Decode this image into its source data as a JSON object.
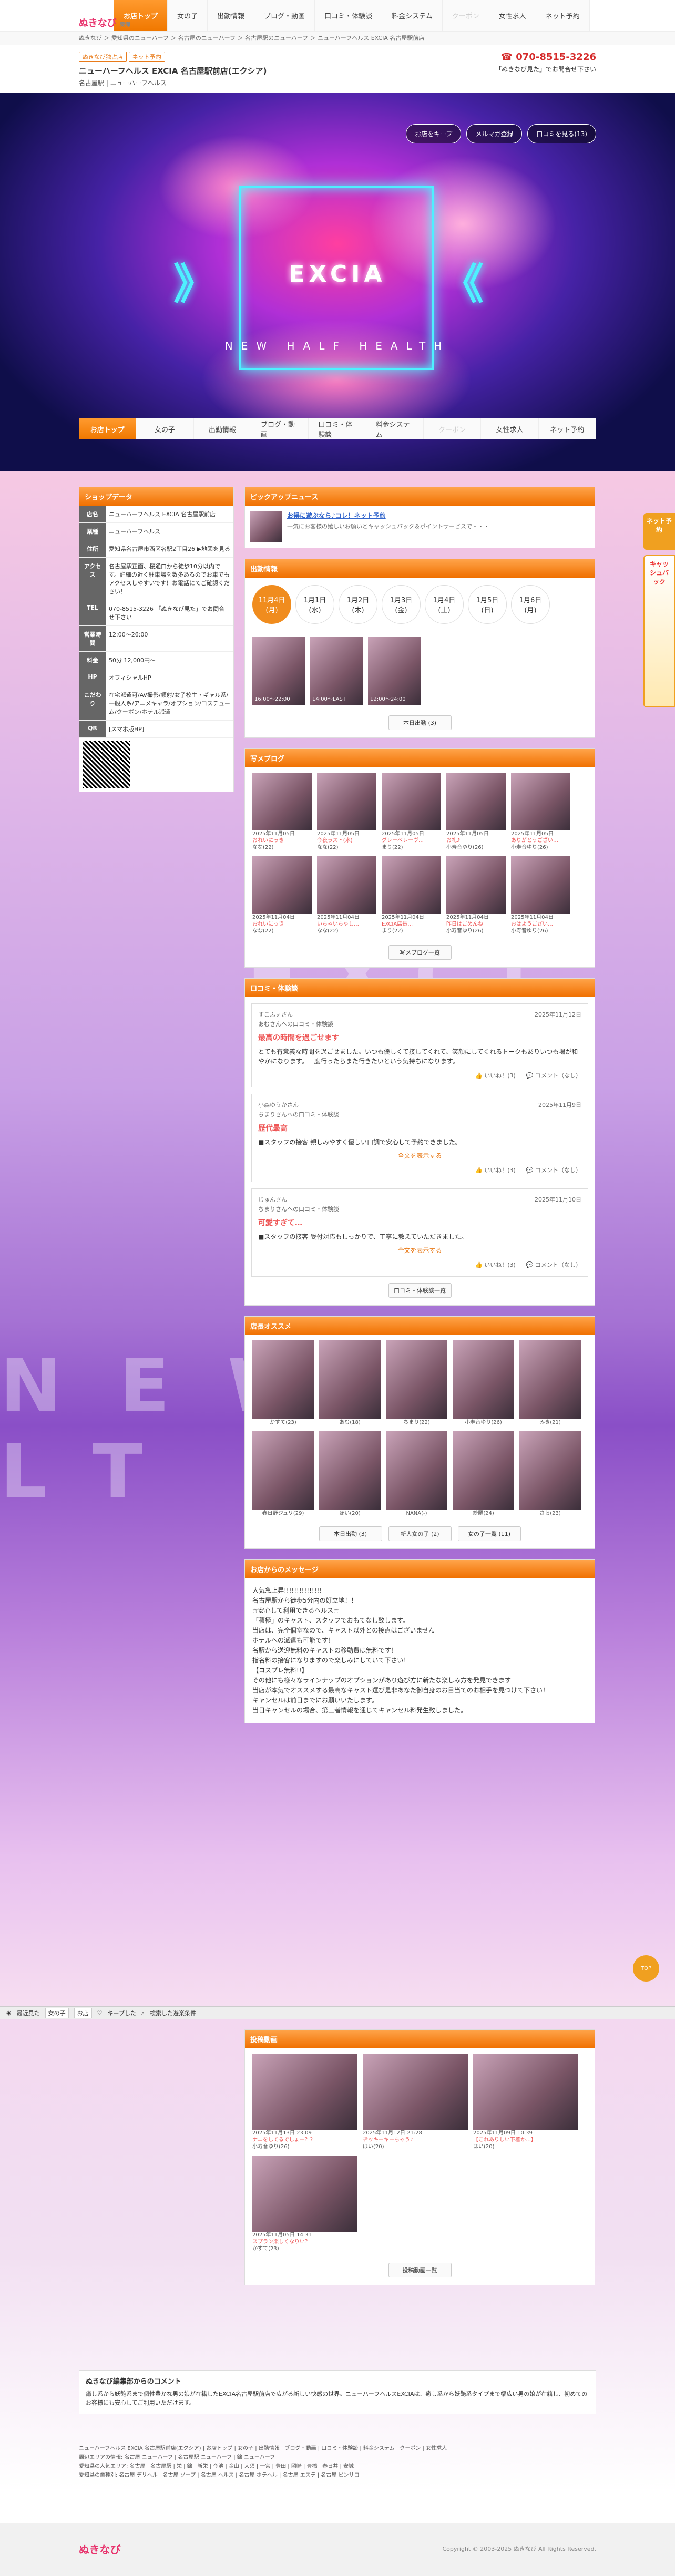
{
  "nav": {
    "logo": "ぬきなび",
    "site_sub": "東海",
    "items": [
      "お店トップ",
      "女の子",
      "出勤情報",
      "ブログ・動画",
      "口コミ・体験談",
      "料金システム",
      "クーポン",
      "女性求人",
      "ネット予約"
    ]
  },
  "breadcrumb": "ぬきなび ＞ 愛知県のニューハーフ ＞ 名古屋のニューハーフ ＞ 名古屋駅のニューハーフ ＞ ニューハーフヘルス EXCIA 名古屋駅前店",
  "shop": {
    "badge1": "ぬきなび独占店",
    "badge2": "ネット予約",
    "name": "ニューハーフヘルス EXCIA 名古屋駅前店(エクシア)",
    "sub": "名古屋駅 | ニューハーフヘルス",
    "tel": "070-8515-3226",
    "tel_note": "「ぬきなび見た」でお問合せ下さい"
  },
  "hero": {
    "btn_keep": "お店をキープ",
    "btn_mail": "メルマガ登録",
    "btn_review": "口コミを見る(13)",
    "logo": "EXCIA",
    "tagline": "NEW HALF HEALTH",
    "chev_left": "》",
    "chev_right": "《"
  },
  "side": {
    "banner1": "ネット予約",
    "banner2": "キャッシュバック",
    "bigtext1": "EXCI",
    "bigtext2": "NEW H LT"
  },
  "shopdata": {
    "title": "ショップデータ",
    "rows": [
      {
        "k": "店名",
        "v": "ニューハーフヘルス EXCIA 名古屋駅前店"
      },
      {
        "k": "業種",
        "v": "ニューハーフヘルス"
      },
      {
        "k": "住所",
        "v": "愛知県名古屋市西区名駅2丁目26 ▶地図を見る"
      },
      {
        "k": "アクセス",
        "v": "名古屋駅正面、桜通口から徒歩10分以内です。詳細の近く駐車場を数多あるのでお車でもアクセスしやすいです！お電話にてご確認ください！"
      },
      {
        "k": "TEL",
        "v": "070-8515-3226 「ぬきなび見た」でお問合せ下さい"
      },
      {
        "k": "営業時間",
        "v": "12:00〜26:00"
      },
      {
        "k": "料金",
        "v": "50分 12,000円〜"
      },
      {
        "k": "HP",
        "v": "オフィシャルHP"
      },
      {
        "k": "こだわり",
        "v": "在宅派遣可/AV撮影/顔射/女子校生・ギャル系/一般人系/アニメキャラ/オプション/コスチューム/クーポン/ホテル派遣"
      },
      {
        "k": "QR",
        "v": "[スマホ版HP]"
      }
    ]
  },
  "pickup": {
    "title": "ピックアップニュース",
    "headline": "お得に遊ぶなら♪コレ！ネット予約",
    "body": "一気にお客様の嬉しいお願いとキャッシュバック＆ポイントサービスで・・・"
  },
  "schedule": {
    "title": "出勤情報",
    "days": [
      {
        "d": "11月4日",
        "w": "(月)"
      },
      {
        "d": "1月1日",
        "w": "(水)"
      },
      {
        "d": "1月2日",
        "w": "(木)"
      },
      {
        "d": "1月3日",
        "w": "(金)"
      },
      {
        "d": "1月4日",
        "w": "(土)"
      },
      {
        "d": "1月5日",
        "w": "(日)"
      },
      {
        "d": "1月6日",
        "w": "(月)"
      }
    ],
    "caps": [
      "16:00〜22:00",
      "14:00〜LAST",
      "12:00〜24:00"
    ],
    "more": "本日出勤 (3)"
  },
  "blog": {
    "title": "写メブログ",
    "items": [
      {
        "t": "2025年11月05日",
        "h": "おれいにっき",
        "n": "なな(22)"
      },
      {
        "t": "2025年11月05日",
        "h": "今夜ラスト(水)",
        "n": "なな(22)"
      },
      {
        "t": "2025年11月05日",
        "h": "グレーベレーヴ…",
        "n": "まり(22)"
      },
      {
        "t": "2025年11月05日",
        "h": "お礼♪",
        "n": "小寿音ゆり(26)"
      },
      {
        "t": "2025年11月05日",
        "h": "ありがとうござい…",
        "n": "小寿音ゆり(26)"
      },
      {
        "t": "2025年11月04日",
        "h": "おれいにっき",
        "n": "なな(22)"
      },
      {
        "t": "2025年11月04日",
        "h": "いちゃいちゃし…",
        "n": "なな(22)"
      },
      {
        "t": "2025年11月04日",
        "h": "EXCIA店長…",
        "n": "まり(22)"
      },
      {
        "t": "2025年11月04日",
        "h": "昨日はごめんね",
        "n": "小寿音ゆり(26)"
      },
      {
        "t": "2025年11月04日",
        "h": "おはようござい…",
        "n": "小寿音ゆり(26)"
      }
    ],
    "more": "写メブログ一覧"
  },
  "reviews": {
    "title": "口コミ・体験談",
    "items": [
      {
        "user": "すこふぇさん",
        "to": "あむさんへの口コミ・体験談",
        "date": "2025年11月12日",
        "head": "最高の時間を過ごせます",
        "body": "とても有意義な時間を過ごせました。いつも優しくて接してくれて、笑顔にしてくれるトークもありいつも場が和やかになります。一度行ったらまた行きたいという気持ちになります。",
        "like": "いいね！(3)",
        "com": "コメント（なし）"
      },
      {
        "user": "小森ゆうかさん",
        "to": "ちまりさんへの口コミ・体験談",
        "date": "2025年11月9日",
        "head": "歴代最高",
        "body": "■スタッフの接客 親しみやすく優しい口調で安心して予約できました。",
        "like": "いいね！(3)",
        "com": "コメント（なし）",
        "more": "全文を表示する"
      },
      {
        "user": "じゅんさん",
        "to": "ちまりさんへの口コミ・体験談",
        "date": "2025年11月10日",
        "head": "可愛すぎて…",
        "body": "■スタッフの接客 受付対応もしっかりで、丁寧に教えていただきました。",
        "like": "いいね！(3)",
        "com": "コメント（なし）",
        "more": "全文を表示する"
      }
    ],
    "more": "口コミ・体験談一覧"
  },
  "girls": {
    "title": "店長オススメ",
    "items": [
      "かすて(23)",
      "あむ(18)",
      "ちまり(22)",
      "小寿音ゆり(26)",
      "みき(21)",
      "春日野ジュリ(29)",
      "ほい(20)",
      "NANA(-)",
      "紗羅(24)",
      "さら(23)"
    ],
    "b1": "本日出勤 (3)",
    "b2": "新人女の子 (2)",
    "b3": "女の子一覧 (11)"
  },
  "message": {
    "title": "お店からのメッセージ",
    "lines": [
      "人気急上昇!!!!!!!!!!!!!!!",
      "名古屋駅から徒歩5分内の好立地！！",
      "☆安心して利用できるヘルス☆",
      "「積極」のキャスト、スタッフでおもてなし致します。",
      "当店は、完全個室なので、キャスト以外との接点はございません",
      "ホテルへの派遣も可能です！",
      "名駅から送迎無料のキャストの移動費は無料です！",
      "指名料の接客になりますので楽しみにしていて下さい！",
      "【コスプレ無料!!】",
      "その他にも様々なラインナップのオプションがあり遊び方に新たな楽しみ方を発見できます",
      "当店が本気でオススメする最高なキャスト選び是非あなた御自身のお目当てのお相手を見つけて下さい！",
      "キャンセルは前日までにお願いいたします。",
      "当日キャンセルの場合、第三者情報を通じてキャンセル料発生致しました。"
    ]
  },
  "posts": {
    "title": "投稿動画",
    "items": [
      {
        "t": "2025年11月13日 23:09",
        "h": "ナニをしてるでしょー？？",
        "n": "小寿音ゆり(26)"
      },
      {
        "t": "2025年11月12日 21:28",
        "h": "ヂッキーキーちゃう♪",
        "n": "ほい(20)"
      },
      {
        "t": "2025年11月09日 10:39",
        "h": "【これありしい下着か…】",
        "n": "ほい(20)"
      },
      {
        "t": "2025年11月05日 14:31",
        "h": "スプラン楽しくなりい？",
        "n": "かすて(23)"
      }
    ],
    "more": "投稿動画一覧"
  },
  "editor": {
    "title": "ぬきなび編集部からのコメント",
    "text": "癒し系から妖艶系まで個性豊かな男の娘が在籍したEXCIA名古屋駅前店で広がる新しい快感の世界。ニューハーフヘルスEXCIAは、癒し系から妖艶系タイプまで幅広い男の娘が在籍し、初めてのお客様にも安心してご利用いただけます。"
  },
  "footlinks": [
    "ニューハーフヘルス EXCIA 名古屋駅前店(エクシア) | お店トップ | 女の子 | 出勤情報 | ブログ・動画 | 口コミ・体験談 | 料金システム | クーポン | 女性求人",
    "周辺エリアの情報: 名古屋 ニューハーフ | 名古屋駅 ニューハーフ | 錦 ニューハーフ",
    "愛知県の人気エリア: 名古屋 | 名古屋駅 | 栄 | 錦 | 新栄 | 今池 | 金山 | 大須 | 一宮 | 豊田 | 岡崎 | 豊橋 | 春日井 | 安城",
    "愛知県の業種別: 名古屋 デリヘル | 名古屋 ソープ | 名古屋 ヘルス | 名古屋 ホテヘル | 名古屋 エステ | 名古屋 ピンサロ"
  ],
  "fixbar": {
    "a": "最近見た",
    "b": "女の子",
    "c": "お店",
    "d": "キープした",
    "e": "検索した遊楽条件"
  },
  "gotop": "TOP",
  "footer": {
    "copy": "Copyright © 2003-2025 ぬきなび All Rights Reserved."
  }
}
